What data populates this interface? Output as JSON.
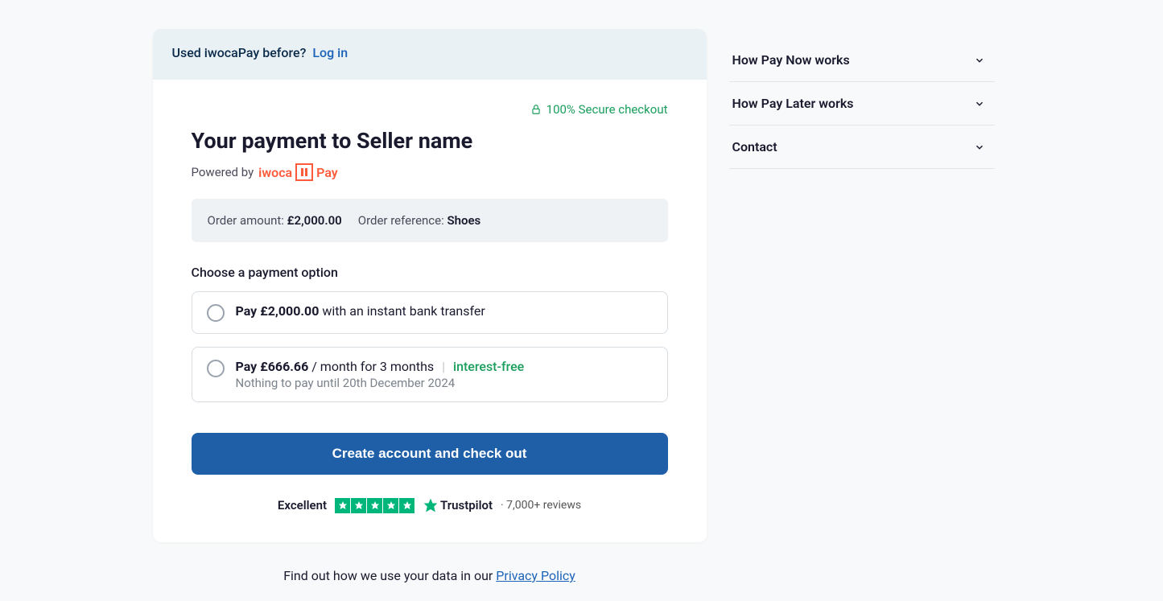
{
  "banner": {
    "prefix": "Used iwocaPay before?",
    "login_text": "Log in"
  },
  "secure_text": "100% Secure checkout",
  "title": "Your payment to Seller name",
  "powered_by": "Powered by",
  "logo": {
    "brand": "iwoca",
    "suffix": "Pay"
  },
  "order": {
    "amount_label": "Order amount: ",
    "amount_value": "£2,000.00",
    "ref_label": "Order reference: ",
    "ref_value": "Shoes"
  },
  "choose_label": "Choose a payment option",
  "option1": {
    "bold": "Pay £2,000.00",
    "rest": " with an instant bank transfer"
  },
  "option2": {
    "bold": "Pay £666.66",
    "rest": " / month for 3 months",
    "separator": "|",
    "badge": "interest-free",
    "sub": "Nothing to pay until 20th December 2024"
  },
  "cta": "Create account and check out",
  "trust": {
    "rating_label": "Excellent",
    "brand": "Trustpilot",
    "reviews": "· 7,000+ reviews"
  },
  "privacy": {
    "prefix": "Find out how we use your data in our ",
    "link": "Privacy Policy"
  },
  "sidebar": {
    "items": [
      "How Pay Now works",
      "How Pay Later works",
      "Contact"
    ]
  }
}
